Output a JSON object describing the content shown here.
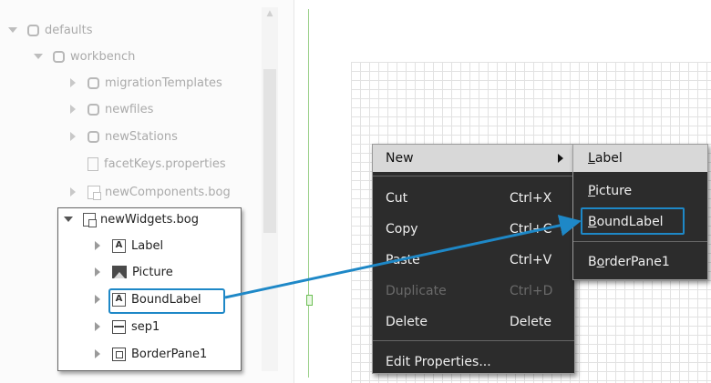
{
  "tree": {
    "items": [
      {
        "label": "defaults",
        "icon": "database-icon",
        "expanded": true
      },
      {
        "label": "workbench",
        "icon": "database-icon",
        "expanded": true
      },
      {
        "label": "migrationTemplates",
        "icon": "database-icon"
      },
      {
        "label": "newfiles",
        "icon": "database-icon"
      },
      {
        "label": "newStations",
        "icon": "database-icon"
      },
      {
        "label": "facetKeys.properties",
        "icon": "file-icon"
      },
      {
        "label": "newComponents.bog",
        "icon": "bog-file-icon"
      }
    ],
    "highlighted_box": {
      "parent": {
        "label": "newWidgets.bog",
        "icon": "bog-file-icon",
        "expanded": true
      },
      "children": [
        {
          "label": "Label",
          "icon": "label-widget-icon"
        },
        {
          "label": "Picture",
          "icon": "picture-widget-icon"
        },
        {
          "label": "BoundLabel",
          "icon": "label-widget-icon",
          "highlighted": true
        },
        {
          "label": "sep1",
          "icon": "separator-widget-icon"
        },
        {
          "label": "BorderPane1",
          "icon": "borderpane-widget-icon"
        }
      ]
    }
  },
  "context_menu": {
    "items": [
      {
        "label": "New",
        "shortcut": "",
        "submenu": true,
        "active": true
      },
      {
        "label": "Cut",
        "shortcut": "Ctrl+X"
      },
      {
        "label": "Copy",
        "shortcut": "Ctrl+C"
      },
      {
        "label": "Paste",
        "shortcut": "Ctrl+V"
      },
      {
        "label": "Duplicate",
        "shortcut": "Ctrl+D",
        "disabled": true
      },
      {
        "label": "Delete",
        "shortcut": "Delete"
      },
      {
        "label": "Edit Properties...",
        "shortcut": ""
      }
    ]
  },
  "submenu": {
    "items": [
      {
        "label": "Label",
        "mnemonic": "L",
        "rest": "abel"
      },
      {
        "label": "Picture",
        "mnemonic": "P",
        "rest": "icture"
      },
      {
        "label": "BoundLabel",
        "mnemonic": "B",
        "rest": "oundLabel",
        "highlighted": true
      },
      {
        "label": "BorderPane1",
        "mnemonic": "o",
        "pre": "B",
        "rest": "rderPane1"
      }
    ]
  },
  "colors": {
    "highlight": "#1e88c7",
    "menu_bg": "#2c2c2c",
    "menu_active_bg": "#d8d8d8",
    "guide_line": "#9bd08a"
  }
}
